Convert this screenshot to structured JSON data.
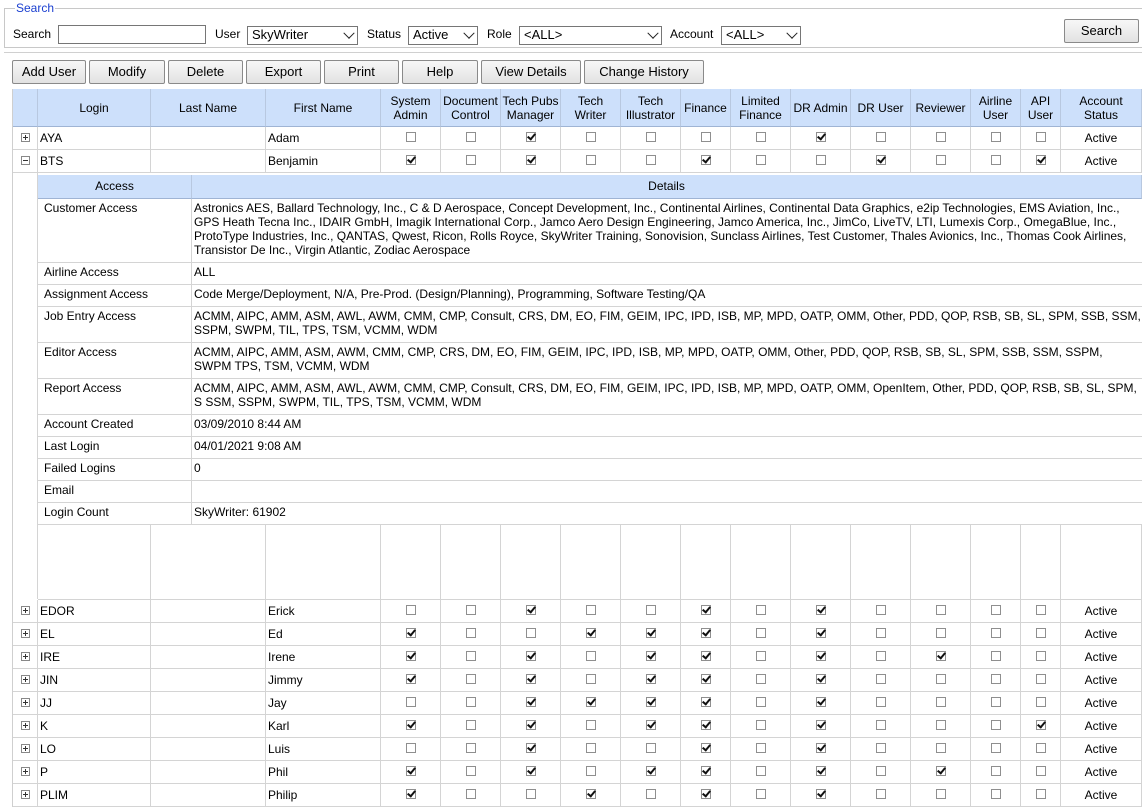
{
  "search": {
    "legend": "Search",
    "search_label": "Search",
    "search_value": "",
    "user_label": "User",
    "user_value": "SkyWriter",
    "status_label": "Status",
    "status_value": "Active",
    "role_label": "Role",
    "role_value": "<ALL>",
    "account_label": "Account",
    "account_value": "<ALL>",
    "search_button": "Search"
  },
  "toolbar": {
    "add_user": "Add User",
    "modify": "Modify",
    "delete": "Delete",
    "export": "Export",
    "print": "Print",
    "help": "Help",
    "view_details": "View Details",
    "change_history": "Change History"
  },
  "columns": {
    "login": "Login",
    "last_name": "Last Name",
    "first_name": "First Name",
    "roles": [
      [
        "System",
        "Admin"
      ],
      [
        "Document",
        "Control"
      ],
      [
        "Tech Pubs",
        "Manager"
      ],
      [
        "Tech",
        "Writer"
      ],
      [
        "Tech",
        "Illustrator"
      ],
      [
        "Finance"
      ],
      [
        "Limited",
        "Finance"
      ],
      [
        "DR Admin"
      ],
      [
        "DR User"
      ],
      [
        "Reviewer"
      ],
      [
        "Airline",
        "User"
      ],
      [
        "API",
        "User"
      ]
    ],
    "account_status": [
      "Account",
      "Status"
    ]
  },
  "users_top": [
    {
      "login": "AYA",
      "last": "",
      "first": "Adam",
      "expanded": false,
      "roles": [
        0,
        0,
        1,
        0,
        0,
        0,
        0,
        1,
        0,
        0,
        0,
        0
      ],
      "status": "Active"
    },
    {
      "login": "BTS",
      "last": "",
      "first": "Benjamin",
      "expanded": true,
      "roles": [
        1,
        0,
        1,
        0,
        0,
        1,
        0,
        0,
        1,
        0,
        0,
        1
      ],
      "status": "Active"
    }
  ],
  "details": {
    "access_header": "Access",
    "details_header": "Details",
    "rows": [
      {
        "key": "Customer Access",
        "value": "Astronics AES, Ballard Technology, Inc., C & D Aerospace, Concept Development, Inc., Continental Airlines, Continental Data Graphics, e2ip Technologies, EMS Aviation, Inc., GPS Heath Tecna Inc., IDAIR GmbH, Imagik International Corp., Jamco Aero Design Engineering, Jamco America, Inc., JimCo, LiveTV, LTI, Lumexis Corp., OmegaBlue, Inc., ProtoType Industries, Inc., QANTAS, Qwest, Ricon, Rolls Royce, SkyWriter Training, Sonovision, Sunclass Airlines, Test Customer, Thales Avionics, Inc., Thomas Cook Airlines, Transistor De Inc., Virgin Atlantic, Zodiac Aerospace"
      },
      {
        "key": "Airline Access",
        "value": "ALL"
      },
      {
        "key": "Assignment Access",
        "value": "Code Merge/Deployment, N/A, Pre-Prod. (Design/Planning), Programming, Software Testing/QA"
      },
      {
        "key": "Job Entry Access",
        "value": "ACMM, AIPC, AMM, ASM, AWL, AWM, CMM, CMP, Consult, CRS, DM, EO, FIM, GEIM, IPC, IPD, ISB, MP, MPD, OATP, OMM, Other, PDD, QOP, RSB, SB, SL, SPM, SSB, SSM, SSPM, SWPM, TIL, TPS, TSM, VCMM, WDM"
      },
      {
        "key": "Editor Access",
        "value": "ACMM, AIPC, AMM, ASM, AWM, CMM, CMP, CRS, DM, EO, FIM, GEIM, IPC, IPD, ISB, MP, MPD, OATP, OMM, Other, PDD, QOP, RSB, SB, SL, SPM, SSB, SSM, SSPM, SWPM TPS, TSM, VCMM, WDM"
      },
      {
        "key": "Report Access",
        "value": "ACMM, AIPC, AMM, ASM, AWL, AWM, CMM, CMP, Consult, CRS, DM, EO, FIM, GEIM, IPC, IPD, ISB, MP, MPD, OATP, OMM, OpenItem, Other, PDD, QOP, RSB, SB, SL, SPM, S SSM, SSPM, SWPM, TIL, TPS, TSM, VCMM, WDM"
      },
      {
        "key": "Account Created",
        "value": "03/09/2010 8:44 AM"
      },
      {
        "key": "Last Login",
        "value": "04/01/2021 9:08 AM"
      },
      {
        "key": "Failed Logins",
        "value": "0"
      },
      {
        "key": "Email",
        "value": ""
      },
      {
        "key": "Login Count",
        "value": "SkyWriter: 61902"
      }
    ]
  },
  "users_bottom": [
    {
      "login": "EDOR",
      "last": "",
      "first": "Erick",
      "roles": [
        0,
        0,
        1,
        0,
        0,
        1,
        0,
        1,
        0,
        0,
        0,
        0
      ],
      "status": "Active"
    },
    {
      "login": "EL",
      "last": "",
      "first": "Ed",
      "roles": [
        1,
        0,
        0,
        1,
        1,
        1,
        0,
        1,
        0,
        0,
        0,
        0
      ],
      "status": "Active"
    },
    {
      "login": "IRE",
      "last": "",
      "first": "Irene",
      "roles": [
        1,
        0,
        1,
        0,
        1,
        1,
        0,
        1,
        0,
        1,
        0,
        0
      ],
      "status": "Active"
    },
    {
      "login": "JIN",
      "last": "",
      "first": "Jimmy",
      "roles": [
        1,
        0,
        1,
        0,
        1,
        1,
        0,
        1,
        0,
        0,
        0,
        0
      ],
      "status": "Active"
    },
    {
      "login": "JJ",
      "last": "",
      "first": "Jay",
      "roles": [
        0,
        0,
        1,
        1,
        1,
        1,
        0,
        1,
        0,
        0,
        0,
        0
      ],
      "status": "Active"
    },
    {
      "login": "K",
      "last": "",
      "first": "Karl",
      "roles": [
        1,
        0,
        1,
        0,
        1,
        1,
        0,
        1,
        0,
        0,
        0,
        1
      ],
      "status": "Active"
    },
    {
      "login": "LO",
      "last": "",
      "first": "Luis",
      "roles": [
        0,
        0,
        1,
        0,
        0,
        1,
        0,
        1,
        0,
        0,
        0,
        0
      ],
      "status": "Active"
    },
    {
      "login": "P",
      "last": "",
      "first": "Phil",
      "roles": [
        1,
        0,
        1,
        0,
        1,
        1,
        0,
        1,
        0,
        1,
        0,
        0
      ],
      "status": "Active"
    },
    {
      "login": "PLIM",
      "last": "",
      "first": "Philip",
      "roles": [
        1,
        0,
        0,
        1,
        0,
        1,
        0,
        1,
        0,
        0,
        0,
        0
      ],
      "status": "Active"
    }
  ]
}
